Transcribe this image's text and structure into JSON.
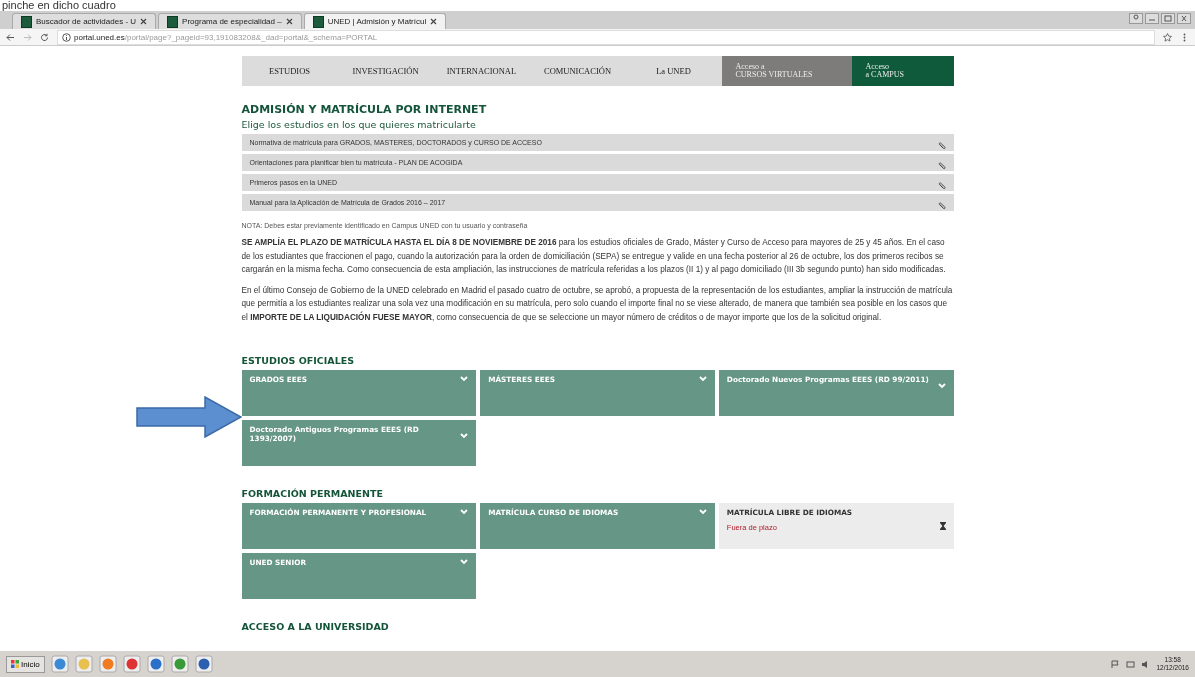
{
  "caption": "pinche en dicho cuadro",
  "browser": {
    "tabs": [
      {
        "title": "Buscador de actividades - U",
        "selected": false
      },
      {
        "title": "Programa de especialidad –",
        "selected": false
      },
      {
        "title": "UNED | Admisión y Matrícul",
        "selected": true
      }
    ],
    "address": {
      "domain": "portal.uned.es",
      "path": "/portal/page?_pageid=93,191083208&_dad=portal&_schema=PORTAL"
    }
  },
  "nav": [
    {
      "label": "ESTUDIOS",
      "kind": "plain"
    },
    {
      "label": "INVESTIGACIÓN",
      "kind": "plain"
    },
    {
      "label": "INTERNACIONAL",
      "kind": "plain"
    },
    {
      "label": "COMUNICACIÓN",
      "kind": "plain"
    },
    {
      "label": "La UNED",
      "kind": "plain"
    },
    {
      "label": "Acceso a\nCURSOS VIRTUALES",
      "kind": "grey"
    },
    {
      "label": "Acceso\na CAMPUS",
      "kind": "green"
    }
  ],
  "title": "ADMISIÓN Y MATRÍCULA POR INTERNET",
  "subtitle": "Elige los estudios en los que quieres matricularte",
  "links": [
    "Normativa de matrícula para GRADOS, MASTERES, DOCTORADOS y CURSO DE ACCESO",
    "Orientaciones para planificar bien tu matrícula - PLAN DE ACOGIDA",
    "Primeros pasos en la UNED",
    "Manual para la Aplicación de Matrícula de Grados 2016 – 2017"
  ],
  "note": "NOTA: Debes estar previamente identificado en Campus UNED con tu usuario y contraseña",
  "paragraphs": [
    "**SE AMPLÍA EL PLAZO DE MATRÍCULA HASTA EL DÍA 8 DE NOVIEMBRE DE 2016** para los estudios oficiales de Grado, Máster y Curso de Acceso para mayores de 25 y 45 años. En el caso de los estudiantes que fraccionen el pago, cuando la autorización para la orden de domiciliación (SEPA) se entregue y valide en una fecha posterior al 26 de octubre, los dos primeros recibos se cargarán en la misma fecha. Como consecuencia de esta ampliación, las instrucciones de matrícula referidas a los plazos (II 1) y al pago domiciliado (III 3b segundo punto) han sido modificadas.",
    "En el último Consejo de Gobierno de la UNED celebrado en Madrid el pasado cuatro de octubre, se aprobó, a propuesta de la representación de los estudiantes, ampliar la instrucción de matrícula que permitía a los estudiantes realizar una sola vez una modificación en su matrícula, pero solo cuando el importe final no se viese alterado, de manera que también sea posible en los casos que el **IMPORTE DE LA LIQUIDACIÓN FUESE MAYOR**, como consecuencia de que se seleccione un mayor número de créditos o de mayor importe que los de la solicitud original."
  ],
  "sections": [
    {
      "heading": "ESTUDIOS OFICIALES",
      "tiles": [
        {
          "kind": "menu",
          "label": "GRADOS EEES"
        },
        {
          "kind": "menu",
          "label": "MÁSTERES EEES"
        },
        {
          "kind": "menu",
          "label": "Doctorado Nuevos Programas EEES (RD 99/2011)"
        },
        {
          "kind": "menu",
          "label": "Doctorado Antiguos Programas EEES (RD 1393/2007)"
        }
      ]
    },
    {
      "heading": "FORMACIÓN PERMANENTE",
      "tiles": [
        {
          "kind": "menu",
          "label": "FORMACIÓN PERMANENTE Y PROFESIONAL"
        },
        {
          "kind": "menu",
          "label": "MATRÍCULA CURSO DE IDIOMAS"
        },
        {
          "kind": "closed",
          "label": "MATRÍCULA LIBRE DE IDIOMAS",
          "status": "Fuera de plazo"
        },
        {
          "kind": "menu",
          "label": "UNED SENIOR"
        }
      ]
    },
    {
      "heading": "ACCESO A LA UNIVERSIDAD"
    }
  ],
  "taskbar": {
    "start": "Inicio",
    "time": "13:58",
    "date": "12/12/2016"
  }
}
